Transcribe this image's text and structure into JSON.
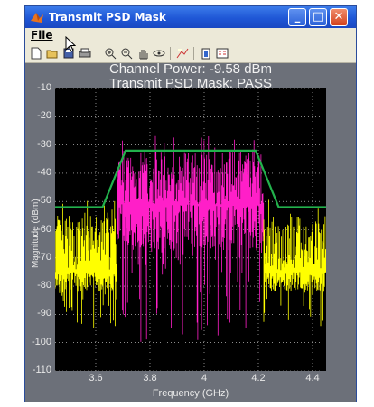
{
  "window": {
    "title": "Transmit PSD Mask",
    "menu_file": "File",
    "controls": {
      "minimize": "_",
      "maximize": "□",
      "close": "✕"
    }
  },
  "toolbar_icons": [
    "new-file-icon",
    "open-icon",
    "save-icon",
    "print-icon",
    "zoom-in-icon",
    "zoom-out-icon",
    "pan-icon",
    "rotate-icon",
    "data-cursor-icon",
    "colorbar-icon",
    "legend-icon"
  ],
  "header": {
    "line1": "Channel Power: -9.58 dBm",
    "line2": "Transmit PSD Mask: PASS"
  },
  "chart_data": {
    "type": "line",
    "xlabel": "Frequency (GHz)",
    "ylabel": "Magnitude (dBm)",
    "xlim": [
      3.45,
      4.45
    ],
    "ylim": [
      -110,
      -10
    ],
    "xticks": [
      3.6,
      3.8,
      4.0,
      4.2,
      4.4
    ],
    "xtick_labels": [
      "3.6",
      "3.8",
      "4",
      "4.2",
      "4.4"
    ],
    "yticks": [
      -10,
      -20,
      -30,
      -40,
      -50,
      -60,
      -70,
      -80,
      -90,
      -100,
      -110
    ],
    "ytick_labels": [
      "-10",
      "-20",
      "-30",
      "-40",
      "-50",
      "-60",
      "-70",
      "-80",
      "-90",
      "-100",
      "-110"
    ],
    "grid": true,
    "series": [
      {
        "color": "#ffff00",
        "region": [
          3.45,
          3.68
        ],
        "level": [
          -75,
          -55
        ],
        "floor": -95
      },
      {
        "color": "#ff1fc8",
        "region": [
          3.68,
          4.22
        ],
        "level": [
          -51,
          -32
        ],
        "floor": -100
      },
      {
        "color": "#ffff00",
        "region": [
          4.22,
          4.45
        ],
        "level": [
          -75,
          -55
        ],
        "floor": -95
      }
    ],
    "mask": {
      "color": "#22b14c",
      "x": [
        3.45,
        3.625,
        3.71,
        4.19,
        4.275,
        4.45
      ],
      "y": [
        -52,
        -52,
        -32,
        -32,
        -52,
        -52
      ]
    }
  }
}
